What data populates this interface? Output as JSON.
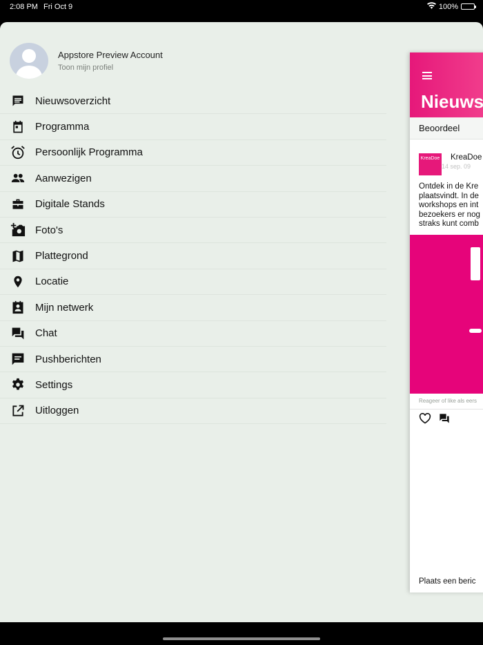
{
  "status_bar": {
    "time": "2:08 PM",
    "date": "Fri Oct 9",
    "battery": "100%"
  },
  "profile": {
    "name": "Appstore Preview Account",
    "subtitle": "Toon mijn profiel"
  },
  "menu": [
    {
      "label": "Nieuwsoverzicht",
      "icon": "news-chat-icon"
    },
    {
      "label": "Programma",
      "icon": "calendar-icon"
    },
    {
      "label": "Persoonlijk Programma",
      "icon": "alarm-clock-icon"
    },
    {
      "label": "Aanwezigen",
      "icon": "people-icon"
    },
    {
      "label": "Digitale Stands",
      "icon": "briefcase-icon"
    },
    {
      "label": "Foto's",
      "icon": "add-photo-icon"
    },
    {
      "label": "Plattegrond",
      "icon": "map-icon"
    },
    {
      "label": "Locatie",
      "icon": "location-pin-icon"
    },
    {
      "label": "Mijn netwerk",
      "icon": "contact-card-icon"
    },
    {
      "label": "Chat",
      "icon": "forum-icon"
    },
    {
      "label": "Pushberichten",
      "icon": "message-icon"
    },
    {
      "label": "Settings",
      "icon": "gear-icon"
    },
    {
      "label": "Uitloggen",
      "icon": "open-external-icon"
    }
  ],
  "preview": {
    "title": "Nieuws",
    "rate_label": "Beoordeel",
    "logo_text": "KreaDoe",
    "author": "KreaDoe",
    "date": "14 sep. 09",
    "body_lines": [
      "Ontdek in de Kre",
      "plaatsvindt. In de",
      "workshops en int",
      "bezoekers er nog",
      "straks kunt comb"
    ],
    "react_hint": "Reageer of like als eers",
    "footer": "Plaats een beric",
    "brand_color": "#e6187a"
  }
}
